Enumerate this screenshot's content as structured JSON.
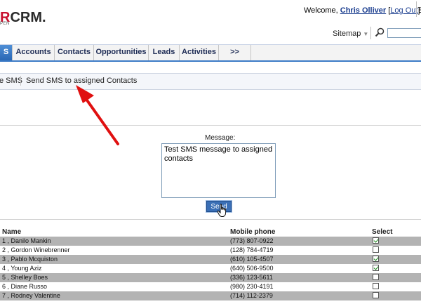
{
  "header": {
    "logo_main": "R",
    "logo_rest": "CRM.",
    "logo_sub": "PEN",
    "welcome_prefix": "Welcome, ",
    "user_name": "Chris Olliver",
    "logout_label": "Log Out",
    "partial_char": "E",
    "sitemap_label": "Sitemap",
    "search_placeholder": ""
  },
  "tabs": [
    {
      "label": "S",
      "active": true
    },
    {
      "label": "Accounts"
    },
    {
      "label": "Contacts"
    },
    {
      "label": "Opportunities"
    },
    {
      "label": "Leads"
    },
    {
      "label": "Activities"
    },
    {
      "label": ">>"
    }
  ],
  "toolbar": {
    "items": [
      "e SMS",
      "Send SMS to assigned Contacts"
    ]
  },
  "form": {
    "message_label": "Message:",
    "message_value": "Test SMS message to assigned contacts",
    "send_label": "Send"
  },
  "table": {
    "headers": {
      "name": "Name",
      "phone": "Mobile phone",
      "select": "Select"
    },
    "rows": [
      {
        "name": "1 , Danilo Mankin",
        "phone": "(773) 807-0922",
        "checked": true
      },
      {
        "name": "2 , Gordon Winebrenner",
        "phone": "(128) 784-4719",
        "checked": false
      },
      {
        "name": "3 , Pablo Mcquiston",
        "phone": "(610) 105-4507",
        "checked": true
      },
      {
        "name": "4 , Young Aziz",
        "phone": "(640) 506-9500",
        "checked": true
      },
      {
        "name": "5 , Shelley Boes",
        "phone": "(336) 123-5611",
        "checked": false
      },
      {
        "name": "6 , Diane Russo",
        "phone": "(980) 230-4191",
        "checked": false
      },
      {
        "name": "7 , Rodney Valentine",
        "phone": "(714) 112-2379",
        "checked": false
      }
    ]
  },
  "colors": {
    "tab_active": "#2f6fbf",
    "row_shade": "#b3b3b3",
    "arrow": "#e01010",
    "link": "#1a3d8f"
  }
}
